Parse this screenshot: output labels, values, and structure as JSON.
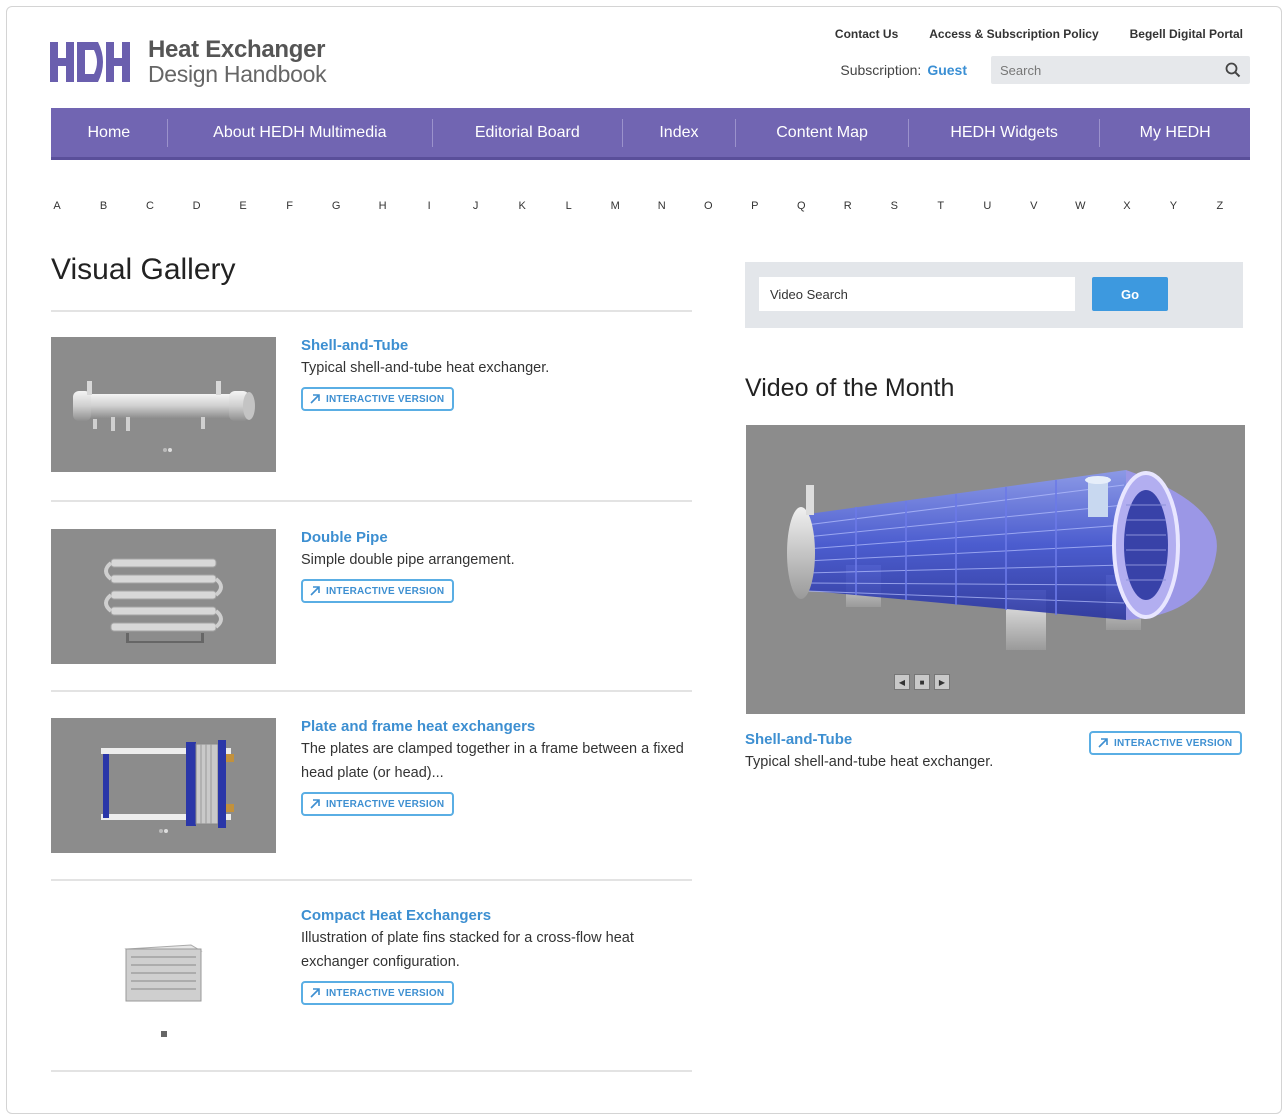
{
  "brand": {
    "logo_text": "HEDH",
    "title_line1": "Heat Exchanger",
    "title_line2": "Design Handbook",
    "color": "#7165b2"
  },
  "top_links": [
    "Contact Us",
    "Access & Subscription Policy",
    "Begell Digital Portal"
  ],
  "subscription": {
    "label": "Subscription:",
    "value": "Guest"
  },
  "search": {
    "placeholder": "Search",
    "icon": "search-icon"
  },
  "nav": {
    "items": [
      "Home",
      "About HEDH Multimedia",
      "Editorial Board",
      "Index",
      "Content Map",
      "HEDH Widgets",
      "My HEDH"
    ]
  },
  "alphabet": [
    "A",
    "B",
    "C",
    "D",
    "E",
    "F",
    "G",
    "H",
    "I",
    "J",
    "K",
    "L",
    "M",
    "N",
    "O",
    "P",
    "Q",
    "R",
    "S",
    "T",
    "U",
    "V",
    "W",
    "X",
    "Y",
    "Z"
  ],
  "gallery": {
    "title": "Visual Gallery",
    "items": [
      {
        "title": "Shell-and-Tube",
        "description": "Typical shell-and-tube heat exchanger.",
        "button": "INTERACTIVE VERSION"
      },
      {
        "title": "Double Pipe",
        "description": "Simple double pipe arrangement.",
        "button": "INTERACTIVE VERSION"
      },
      {
        "title": "Plate and frame heat exchangers",
        "description": "The plates are clamped together in a frame between a fixed head plate (or head)...",
        "button": "INTERACTIVE VERSION"
      },
      {
        "title": "Compact Heat Exchangers",
        "description": "Illustration of plate fins stacked for a cross-flow heat exchanger configuration.",
        "button": "INTERACTIVE VERSION"
      }
    ]
  },
  "video_search": {
    "placeholder": "Video Search",
    "button": "Go"
  },
  "video_of_month": {
    "heading": "Video of the Month",
    "title": "Shell-and-Tube",
    "description": "Typical shell-and-tube heat exchanger.",
    "button": "INTERACTIVE VERSION"
  },
  "colors": {
    "link": "#3d8fd1",
    "button_border": "#5aaee4",
    "go_button": "#3d99df",
    "thumb_bg": "#8c8c8c"
  }
}
